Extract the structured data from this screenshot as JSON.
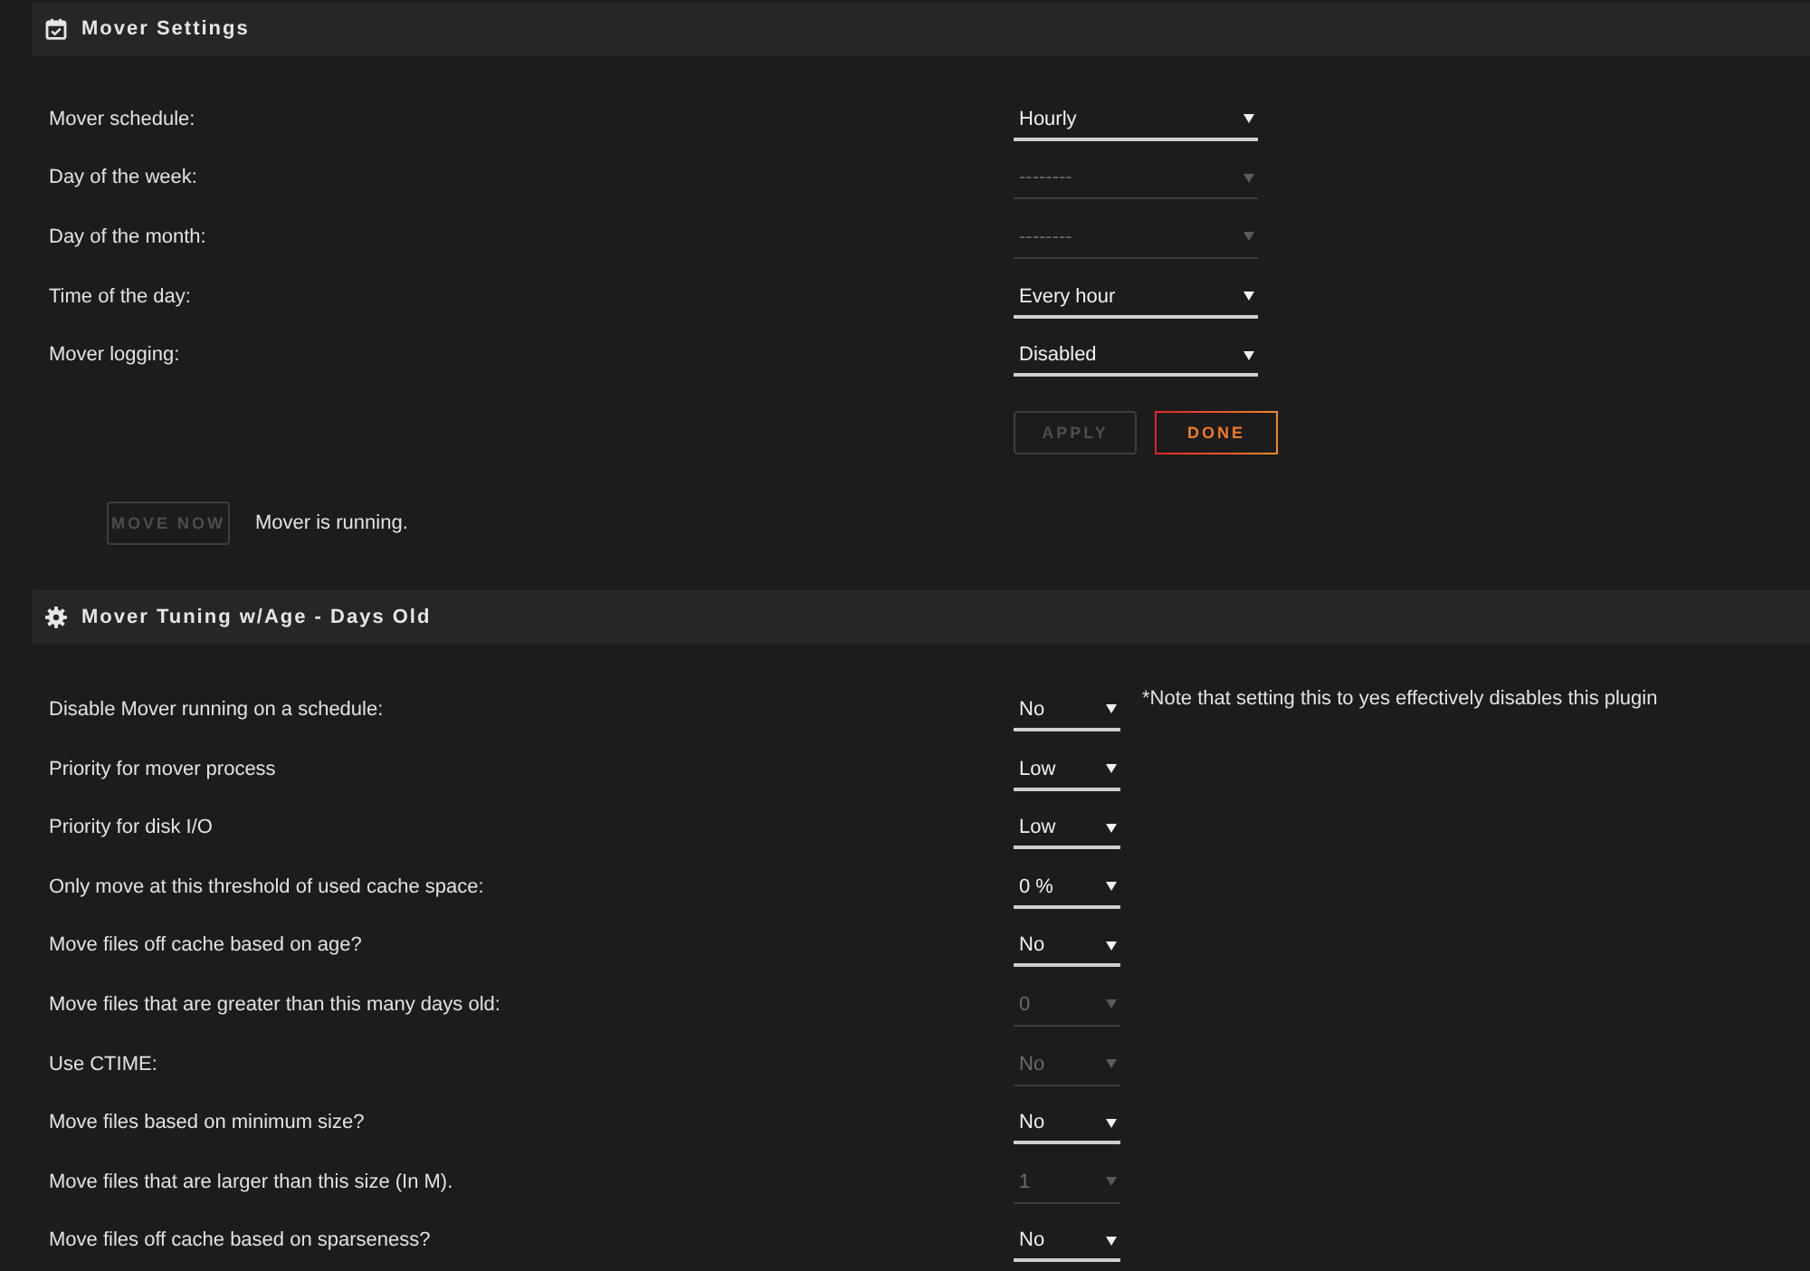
{
  "sections": [
    {
      "title": "Mover Settings",
      "fields": [
        {
          "label": "Mover schedule:",
          "value": "Hourly",
          "disabled": false
        },
        {
          "label": "Day of the week:",
          "value": "--------",
          "disabled": true
        },
        {
          "label": "Day of the month:",
          "value": "--------",
          "disabled": true
        },
        {
          "label": "Time of the day:",
          "value": "Every hour",
          "disabled": false
        },
        {
          "label": "Mover logging:",
          "value": "Disabled",
          "disabled": false
        }
      ],
      "buttons": [
        {
          "label": "APPLY",
          "disabled": true
        },
        {
          "label": "DONE",
          "disabled": false
        }
      ],
      "move_now": {
        "label": "MOVE NOW",
        "disabled": true
      },
      "status": "Mover is running."
    },
    {
      "title": "Mover Tuning w/Age - Days Old",
      "fields": [
        {
          "label": "Disable Mover running on a schedule:",
          "value": "No",
          "disabled": false,
          "note": "*Note that setting this to yes effectively disables this plugin"
        },
        {
          "label": "Priority for mover process",
          "value": "Low",
          "disabled": false
        },
        {
          "label": "Priority for disk I/O",
          "value": "Low",
          "disabled": false
        },
        {
          "label": "Only move at this threshold of used cache space:",
          "value": "0 %",
          "disabled": false
        },
        {
          "label": "Move files off cache based on age?",
          "value": "No",
          "disabled": false
        },
        {
          "label": "Move files that are greater than this many days old:",
          "value": "0",
          "disabled": true
        },
        {
          "label": "Use CTIME:",
          "value": "No",
          "disabled": true
        },
        {
          "label": "Move files based on minimum size?",
          "value": "No",
          "disabled": false
        },
        {
          "label": "Move files that are larger than this size (In M).",
          "value": "1",
          "disabled": true
        },
        {
          "label": "Move files off cache based on sparseness?",
          "value": "No",
          "disabled": false
        }
      ]
    }
  ]
}
